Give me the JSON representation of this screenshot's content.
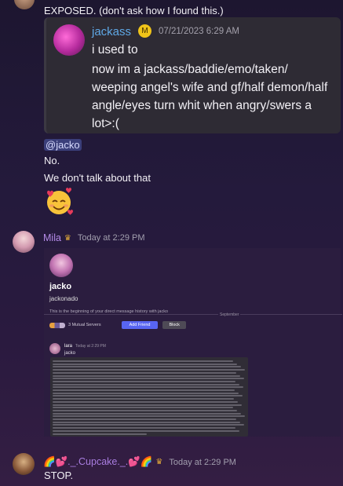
{
  "top_message": {
    "text": "EXPOSED. (don't ask how I found this.)"
  },
  "quote": {
    "author": "jackass",
    "timestamp": "07/21/2023 6:29 AM",
    "lines": [
      "i used to",
      "now im a jackass/baddie/emo/taken/",
      "weeping angel's wife and gf/half demon/half",
      "angle/eyes turn whit when angry/swers a",
      "lot>:("
    ]
  },
  "after_quote": {
    "mention": "@jacko",
    "line1": "No.",
    "line2": "We don't talk about that",
    "emoji": "smiling-face-with-hearts"
  },
  "mila_message": {
    "username": "Mila",
    "timestamp": "Today at 2:29 PM",
    "username_color": "#b58be8",
    "screenshot": {
      "profile_name": "jacko",
      "profile_handle": "jackonado",
      "intro_text": "This is the beginning of your direct message history with jacko",
      "mutual_servers": "3 Mutual Servers",
      "add_friend_label": "Add Friend",
      "block_label": "Block",
      "divider_label": "September",
      "inner_author": "lara",
      "inner_time": "Today at 2:29 PM",
      "inner_text": "jacko"
    }
  },
  "cupcake_message": {
    "username": "🌈💕._.Cupcake._.💕🌈",
    "timestamp": "Today at 2:29 PM",
    "username_color": "#a97de0",
    "text": "STOP."
  }
}
